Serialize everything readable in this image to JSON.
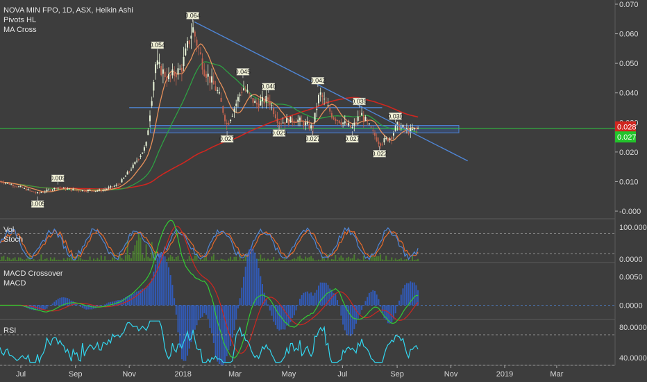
{
  "colors": {
    "background": "#3d3d3d",
    "up": "#e8f4d8",
    "down": "#c0634f",
    "ma_short": "#e8905a",
    "ma_mid": "#2ea043",
    "ma_long": "#d0261f",
    "trendline": "#4f86d6",
    "horizontal": "#2ecc40",
    "price_tag": "#d0261f",
    "price_tag2": "#22c32b",
    "stoch_k": "#4f86d6",
    "stoch_d": "#e86a2a",
    "volume": "#4f8f2c",
    "macd": "#33cc33",
    "signal": "#d0261f",
    "histogram": "#2f5fcc",
    "rsi": "#32d7f0"
  },
  "chart_data": {
    "type": "candlestick",
    "symbol_title": "NOVA MIN FPO, 1D, ASX, Heikin Ashi",
    "indicators_main": [
      "Pivots HL",
      "MA Cross"
    ],
    "x_tick_labels": [
      "Jul",
      "Sep",
      "Nov",
      "2018",
      "Mar",
      "May",
      "Jul",
      "Sep",
      "Nov",
      "2019",
      "Mar"
    ],
    "y_ticks": [
      "0.070",
      "0.060",
      "0.050",
      "0.040",
      "0.030",
      "0.020",
      "0.010",
      "-0.000"
    ],
    "ylim": [
      -0.001,
      0.072
    ],
    "current_price_labels": [
      "0.028",
      "0.027"
    ],
    "pivot_labels": [
      {
        "text": "0.064",
        "date": "2018-01-12",
        "value": 0.064
      },
      {
        "text": "0.054",
        "date": "2017-12-03",
        "value": 0.054
      },
      {
        "text": "0.045",
        "date": "2018-03-10",
        "value": 0.045
      },
      {
        "text": "0.040",
        "date": "2018-04-08",
        "value": 0.04
      },
      {
        "text": "0.042",
        "date": "2018-06-03",
        "value": 0.042
      },
      {
        "text": "0.035",
        "date": "2018-07-20",
        "value": 0.035
      },
      {
        "text": "0.030",
        "date": "2018-08-30",
        "value": 0.03
      },
      {
        "text": "0.009",
        "date": "2017-08-12",
        "value": 0.009
      },
      {
        "text": "0.005",
        "date": "2017-07-20",
        "value": 0.005
      },
      {
        "text": "0.027",
        "date": "2018-02-20",
        "value": 0.027
      },
      {
        "text": "0.029",
        "date": "2018-04-20",
        "value": 0.029
      },
      {
        "text": "0.027",
        "date": "2018-05-28",
        "value": 0.027
      },
      {
        "text": "0.027",
        "date": "2018-07-12",
        "value": 0.027
      },
      {
        "text": "0.022",
        "date": "2018-08-12",
        "value": 0.022
      }
    ],
    "trendline": {
      "start": {
        "date": "2018-01-14",
        "value": 0.064
      },
      "end": {
        "date": "2018-11-20",
        "value": 0.017
      }
    },
    "support_zone": [
      0.0265,
      0.029
    ],
    "resistance_line": {
      "start": "2017-11-01",
      "end": "2018-08-15",
      "value": 0.035
    },
    "horizontal_line": 0.028,
    "price_path": [
      [
        "2017-06-10",
        0.01
      ],
      [
        "2017-07-01",
        0.008
      ],
      [
        "2017-07-20",
        0.006
      ],
      [
        "2017-08-12",
        0.008
      ],
      [
        "2017-09-01",
        0.007
      ],
      [
        "2017-10-01",
        0.007
      ],
      [
        "2017-10-20",
        0.009
      ],
      [
        "2017-11-05",
        0.015
      ],
      [
        "2017-11-20",
        0.022
      ],
      [
        "2017-12-01",
        0.05
      ],
      [
        "2017-12-15",
        0.045
      ],
      [
        "2017-12-30",
        0.048
      ],
      [
        "2018-01-12",
        0.062
      ],
      [
        "2018-01-25",
        0.048
      ],
      [
        "2018-02-10",
        0.04
      ],
      [
        "2018-02-20",
        0.029
      ],
      [
        "2018-03-10",
        0.042
      ],
      [
        "2018-03-25",
        0.036
      ],
      [
        "2018-04-08",
        0.038
      ],
      [
        "2018-04-20",
        0.03
      ],
      [
        "2018-05-10",
        0.031
      ],
      [
        "2018-05-28",
        0.028
      ],
      [
        "2018-06-05",
        0.04
      ],
      [
        "2018-06-20",
        0.032
      ],
      [
        "2018-07-12",
        0.028
      ],
      [
        "2018-07-22",
        0.033
      ],
      [
        "2018-08-12",
        0.023
      ],
      [
        "2018-08-25",
        0.025
      ],
      [
        "2018-09-01",
        0.029
      ],
      [
        "2018-09-15",
        0.027
      ],
      [
        "2018-09-25",
        0.028
      ]
    ],
    "panels": [
      {
        "name": "Stoch",
        "labels": [
          "Vol",
          "Stoch"
        ],
        "y_ticks": [
          "100.0000",
          "0.0000"
        ],
        "ylim": [
          0,
          100
        ],
        "levels": [
          80,
          20
        ]
      },
      {
        "name": "MACD",
        "labels": [
          "MACD Crossover",
          "MACD"
        ],
        "y_ticks": [
          "0.0050",
          "0.0000"
        ],
        "ylim": [
          -0.0025,
          0.0075
        ]
      },
      {
        "name": "RSI",
        "labels": [
          "RSI"
        ],
        "y_ticks": [
          "80.0000",
          "40.0000"
        ],
        "ylim": [
          30,
          90
        ],
        "levels": [
          70,
          30
        ]
      }
    ]
  }
}
